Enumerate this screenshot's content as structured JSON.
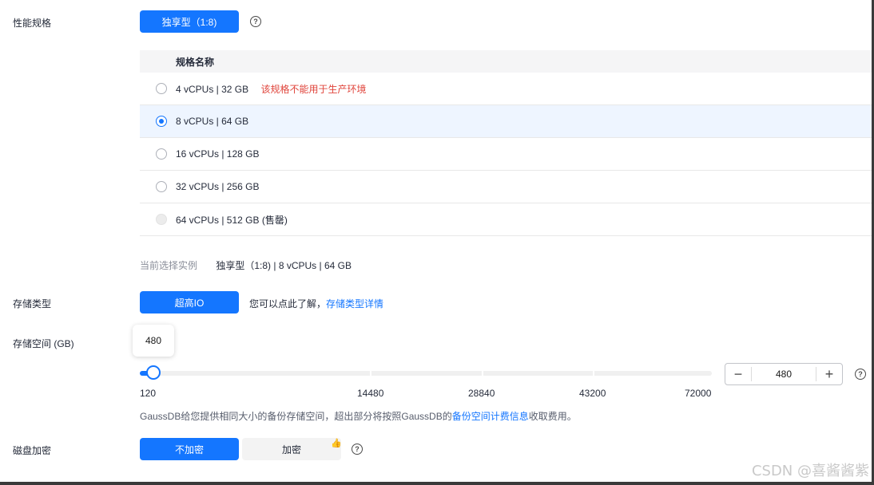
{
  "performance": {
    "label": "性能规格",
    "type_button": "独享型（1:8)",
    "help": "?",
    "table_header": "规格名称",
    "rows": [
      {
        "spec": "4 vCPUs | 32 GB",
        "note": "该规格不能用于生产环境",
        "state": "unchecked"
      },
      {
        "spec": "8 vCPUs | 64 GB",
        "note": "",
        "state": "checked"
      },
      {
        "spec": "16 vCPUs | 128 GB",
        "note": "",
        "state": "unchecked"
      },
      {
        "spec": "32 vCPUs | 256 GB",
        "note": "",
        "state": "unchecked"
      },
      {
        "spec": "64 vCPUs | 512 GB (售罄)",
        "note": "",
        "state": "disabled"
      }
    ],
    "current_label": "当前选择实例",
    "current_type": "独享型（1:8)",
    "current_spec": "| 8 vCPUs | 64 GB"
  },
  "storage_type": {
    "label": "存储类型",
    "button": "超高IO",
    "hint": "您可以点此了解，",
    "link": "存储类型详情"
  },
  "storage_space": {
    "label": "存储空间 (GB)",
    "tooltip": "480",
    "ticks": [
      "120",
      "14480",
      "28840",
      "43200",
      "72000"
    ],
    "value": "480",
    "slider_min": 120,
    "slider_max": 72000,
    "slider_value": 480,
    "minus": "−",
    "plus": "+",
    "help": "?",
    "note_prefix": "GaussDB给您提供相同大小的备份存储空间，超出部分将按照GaussDB的",
    "note_link": "备份空间计费信息",
    "note_suffix": "收取费用。"
  },
  "disk_encryption": {
    "label": "磁盘加密",
    "option_off": "不加密",
    "option_on": "加密",
    "recommend_icon": "👍",
    "help": "?"
  },
  "watermark": "CSDN @喜酱酱紫",
  "colors": {
    "accent": "#1476ff",
    "warning": "#e0453c"
  }
}
